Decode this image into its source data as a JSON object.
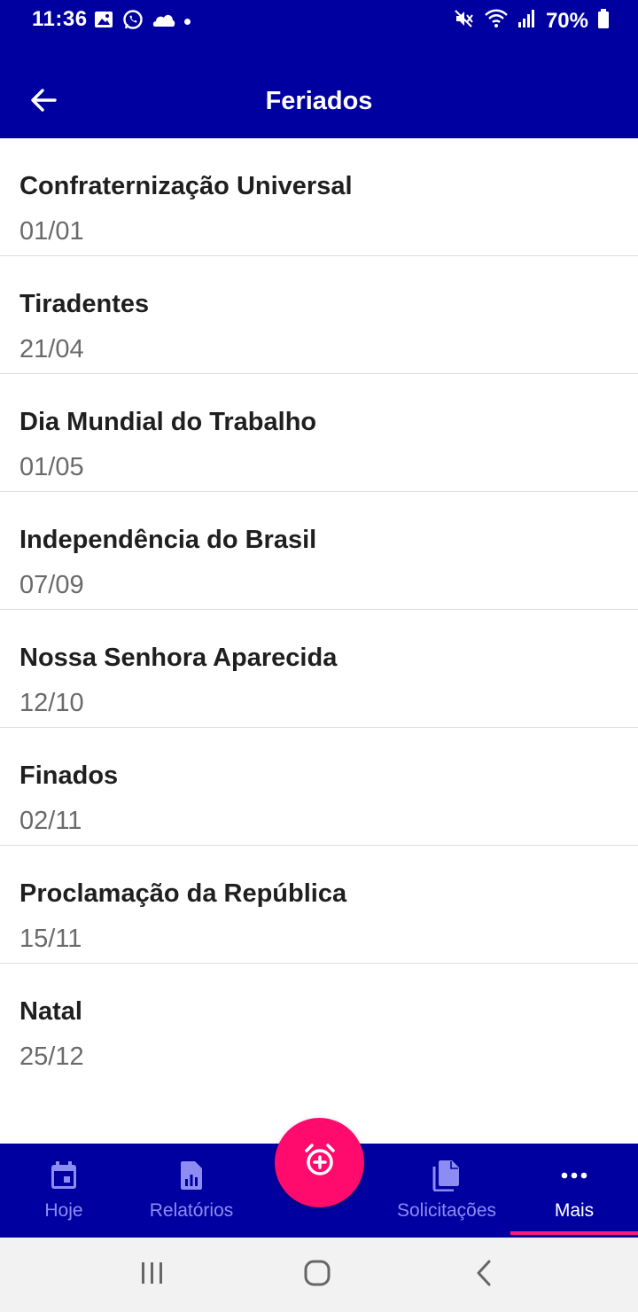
{
  "status_bar": {
    "time": "11:36",
    "battery": "70%",
    "left_icons": [
      "gallery-icon",
      "whatsapp-icon",
      "cloud-icon",
      "dot-icon"
    ],
    "right_icons": [
      "mute-icon",
      "wifi-icon",
      "signal-icon",
      "battery-icon"
    ]
  },
  "header": {
    "title": "Feriados",
    "back_icon": "arrow-left-icon"
  },
  "holidays": [
    {
      "name": "Confraternização Universal",
      "date": "01/01"
    },
    {
      "name": "Tiradentes",
      "date": "21/04"
    },
    {
      "name": "Dia Mundial do Trabalho",
      "date": "01/05"
    },
    {
      "name": "Independência do Brasil",
      "date": "07/09"
    },
    {
      "name": "Nossa Senhora Aparecida",
      "date": "12/10"
    },
    {
      "name": "Finados",
      "date": "02/11"
    },
    {
      "name": "Proclamação da República",
      "date": "15/11"
    },
    {
      "name": "Natal",
      "date": "25/12"
    }
  ],
  "bottom_nav": {
    "items": [
      {
        "label": "Hoje",
        "icon": "calendar-icon"
      },
      {
        "label": "Relatórios",
        "icon": "report-icon"
      },
      {
        "label": "Solicitações",
        "icon": "documents-icon"
      },
      {
        "label": "Mais",
        "icon": "more-icon",
        "active": true
      }
    ],
    "fab_icon": "alarm-add-icon"
  },
  "colors": {
    "primary": "#0000a0",
    "accent": "#ff0a6d",
    "inactive_label": "#8c8cf2"
  }
}
